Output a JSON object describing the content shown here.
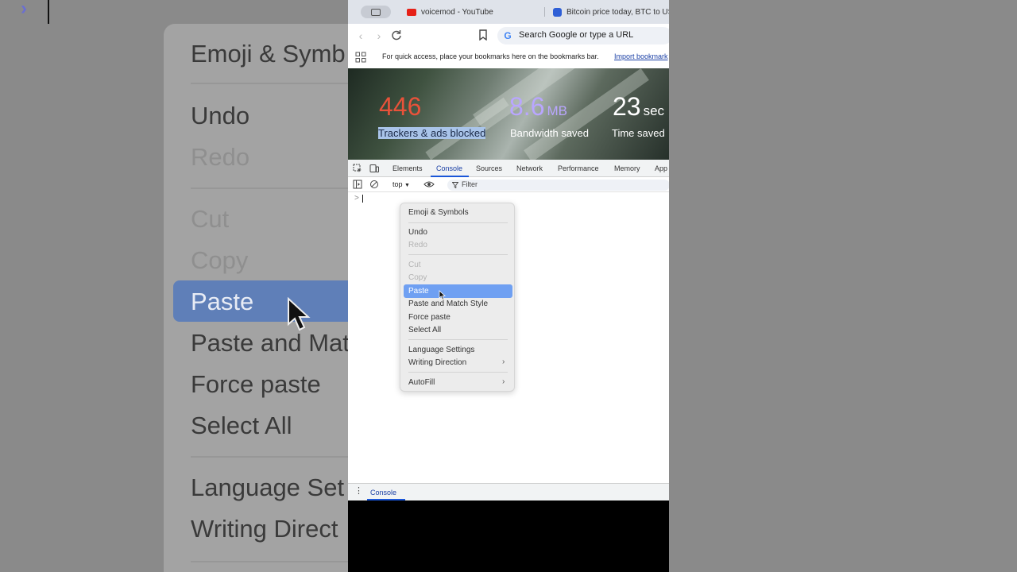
{
  "background_zoom": {
    "menu_items": [
      "Emoji & Symb",
      "Undo",
      "Redo",
      "Cut",
      "Copy",
      "Paste",
      "Paste and Mat",
      "Force paste",
      "Select All",
      "Language Set",
      "Writing Direct"
    ]
  },
  "tabs": [
    {
      "title": "voicemod - YouTube",
      "favicon": "youtube-icon"
    },
    {
      "title": "Bitcoin price today, BTC to US",
      "favicon": "coinmarketcap-icon"
    }
  ],
  "omnibox": {
    "placeholder": "Search Google or type a URL"
  },
  "bookmarks_bar": {
    "message": "For quick access, place your bookmarks here on the bookmarks bar.",
    "link": "Import bookmark"
  },
  "stats": [
    {
      "value": "446",
      "unit": "",
      "label": "Trackers & ads blocked",
      "color": "#e8523a"
    },
    {
      "value": "8.6",
      "unit": "MB",
      "label": "Bandwidth saved",
      "color": "#b9a6ff"
    },
    {
      "value": "23",
      "unit": "sec",
      "label": "Time saved",
      "color": "#ffffff"
    }
  ],
  "devtools": {
    "tabs": [
      "Elements",
      "Console",
      "Sources",
      "Network",
      "Performance",
      "Memory",
      "App"
    ],
    "active_tab": "Console",
    "context": "top",
    "filter_placeholder": "Filter",
    "prompt": ">",
    "drawer_tab": "Console"
  },
  "context_menu": {
    "items": [
      {
        "label": "Emoji & Symbols",
        "state": "enabled"
      },
      {
        "label": "Undo",
        "state": "enabled"
      },
      {
        "label": "Redo",
        "state": "disabled"
      },
      {
        "label": "Cut",
        "state": "disabled"
      },
      {
        "label": "Copy",
        "state": "disabled"
      },
      {
        "label": "Paste",
        "state": "highlighted"
      },
      {
        "label": "Paste and Match Style",
        "state": "enabled"
      },
      {
        "label": "Force paste",
        "state": "enabled"
      },
      {
        "label": "Select All",
        "state": "enabled"
      },
      {
        "label": "Language Settings",
        "state": "enabled"
      },
      {
        "label": "Writing Direction",
        "state": "enabled",
        "submenu": true
      },
      {
        "label": "AutoFill",
        "state": "enabled",
        "submenu": true
      }
    ],
    "highlight_color": "#6fa0f2"
  }
}
